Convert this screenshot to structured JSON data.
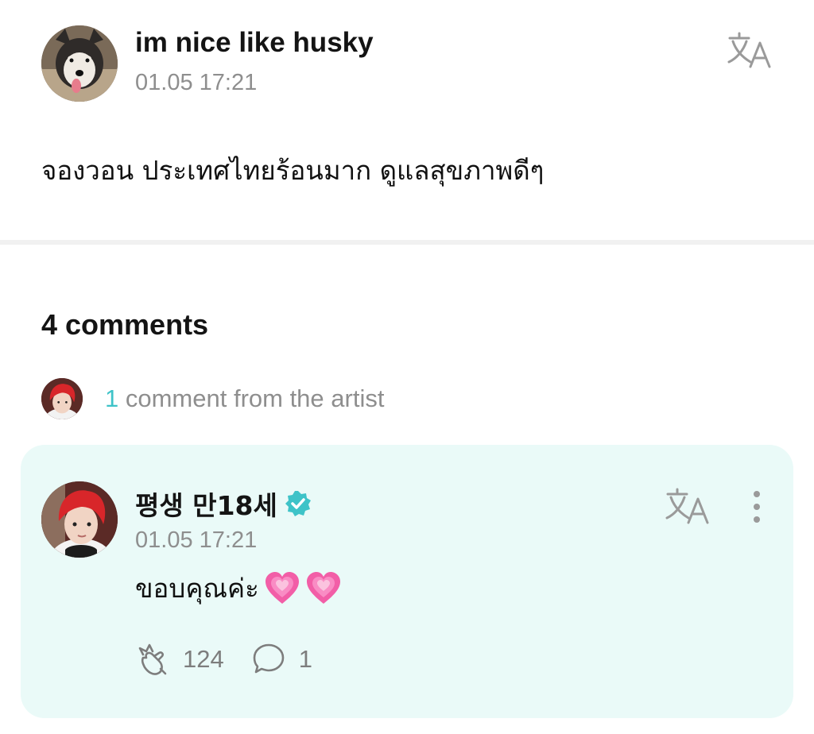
{
  "post": {
    "author": "im nice like husky",
    "time": "01.05 17:21",
    "body": "จองวอน ประเทศไทยร้อนมาก ดูแลสุขภาพดีๆ",
    "translate_icon": "translate-icon"
  },
  "comments": {
    "count_label": "4 comments",
    "artist_count": "1",
    "artist_label": " comment from the artist"
  },
  "artist_comment": {
    "author": "평생 만18세",
    "verified_icon": "verified-badge-icon",
    "time": "01.05 17:21",
    "body": "ขอบคุณค่ะ",
    "emojis": [
      "growing-heart",
      "growing-heart"
    ],
    "likes": "124",
    "replies": "1"
  },
  "colors": {
    "accent": "#3ec3c8",
    "card_bg": "#eafaf8",
    "muted_text": "#8e8e8e"
  }
}
